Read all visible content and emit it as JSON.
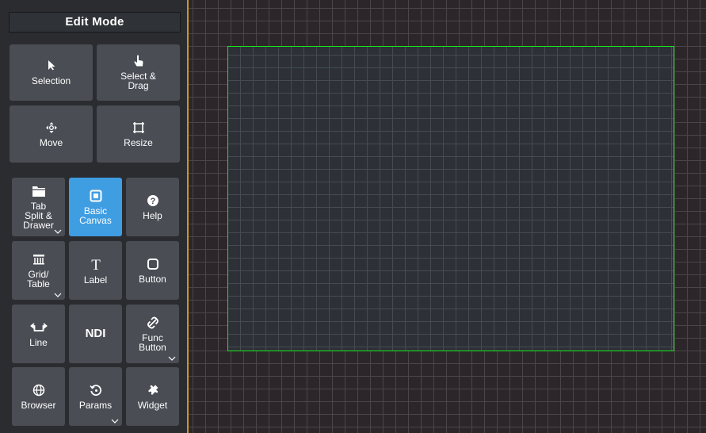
{
  "panel": {
    "title": "Edit Mode",
    "tools": [
      {
        "label": "Selection",
        "icon": "cursor-arrow-icon"
      },
      {
        "label": "Select &\nDrag",
        "icon": "hand-pointer-icon"
      },
      {
        "label": "Move",
        "icon": "move-arrows-icon"
      },
      {
        "label": "Resize",
        "icon": "resize-frame-icon"
      }
    ],
    "widgets": [
      {
        "label": "Tab\nSplit &\nDrawer",
        "icon": "folder-tab-icon",
        "has_dropdown": true
      },
      {
        "label": "Basic\nCanvas",
        "icon": "canvas-square-icon",
        "active": true
      },
      {
        "label": "Help",
        "icon": "help-circle-icon"
      },
      {
        "label": "Grid/\nTable",
        "icon": "grid-table-icon",
        "has_dropdown": true
      },
      {
        "label": "Label",
        "icon": "text-t-icon"
      },
      {
        "label": "Button",
        "icon": "button-outline-icon"
      },
      {
        "label": "Line",
        "icon": "line-connector-icon"
      },
      {
        "label": "NDI",
        "icon": ""
      },
      {
        "label": "Func\nButton",
        "icon": "link-slash-icon",
        "has_dropdown": true
      },
      {
        "label": "Browser",
        "icon": "globe-icon"
      },
      {
        "label": "Params",
        "icon": "history-circle-icon",
        "has_dropdown": true
      },
      {
        "label": "Widget",
        "icon": "puzzle-piece-icon"
      }
    ]
  },
  "colors": {
    "accent": "#3f9de2",
    "divider": "#c79a22",
    "canvas_border": "#19e619",
    "button_bg": "#4a4d54"
  }
}
